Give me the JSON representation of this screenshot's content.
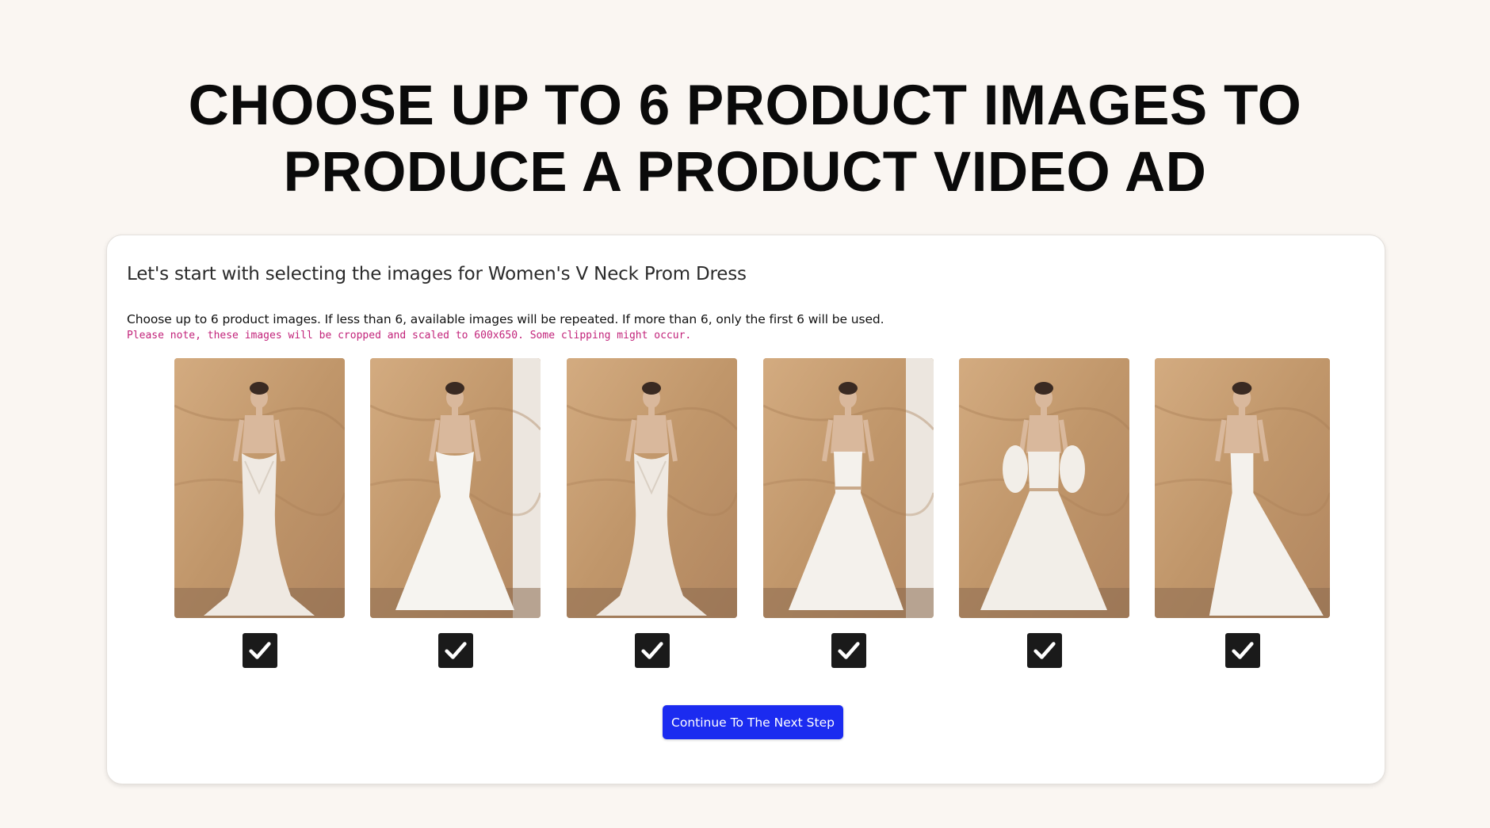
{
  "headline": {
    "line1": "CHOOSE UP TO 6 PRODUCT IMAGES TO",
    "line2": "PRODUCE A PRODUCT VIDEO AD"
  },
  "card": {
    "title": "Let's start with selecting the images for Women's V Neck Prom Dress",
    "instructions": "Choose up to 6 product images. If less than 6, available images will be repeated. If more than 6, only the first 6 will be used.",
    "note": "Please note, these images will be cropped and scaled to 600x650. Some clipping might occur."
  },
  "products": [
    {
      "checked": true,
      "dress": "lace mermaid gown"
    },
    {
      "checked": true,
      "dress": "off-shoulder ball gown"
    },
    {
      "checked": true,
      "dress": "lace mermaid gown"
    },
    {
      "checked": true,
      "dress": "v-neck tulle gown"
    },
    {
      "checked": true,
      "dress": "long-sleeve tulle gown"
    },
    {
      "checked": true,
      "dress": "tulle gown side view"
    }
  ],
  "continue_button": {
    "label": "Continue To The Next Step"
  },
  "colors": {
    "background": "#faf6f2",
    "button": "#1b2bf0",
    "note": "#c2237a",
    "checkbox": "#1a1a1a",
    "backdrop": "#c59b6f"
  }
}
